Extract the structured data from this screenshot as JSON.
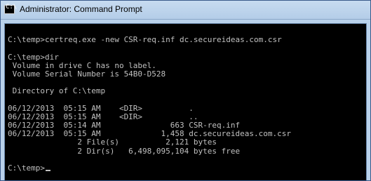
{
  "window": {
    "title": "Administrator: Command Prompt",
    "icon_glyph": "C:\\"
  },
  "console": {
    "lines": [
      "",
      "C:\\temp>certreq.exe -new CSR-req.inf dc.secureideas.com.csr",
      "",
      "C:\\temp>dir",
      " Volume in drive C has no label.",
      " Volume Serial Number is 54B0-D528",
      "",
      " Directory of C:\\temp",
      "",
      "06/12/2013  05:15 AM    <DIR>          .",
      "06/12/2013  05:15 AM    <DIR>          ..",
      "06/12/2013  05:14 AM               663 CSR-req.inf",
      "06/12/2013  05:15 AM             1,458 dc.secureideas.com.csr",
      "               2 File(s)          2,121 bytes",
      "               2 Dir(s)   6,498,095,104 bytes free",
      "",
      "C:\\temp>"
    ]
  },
  "colors": {
    "console_bg": "#000000",
    "console_text": "#c0c0c0",
    "titlebar": "#b9d1ea"
  }
}
